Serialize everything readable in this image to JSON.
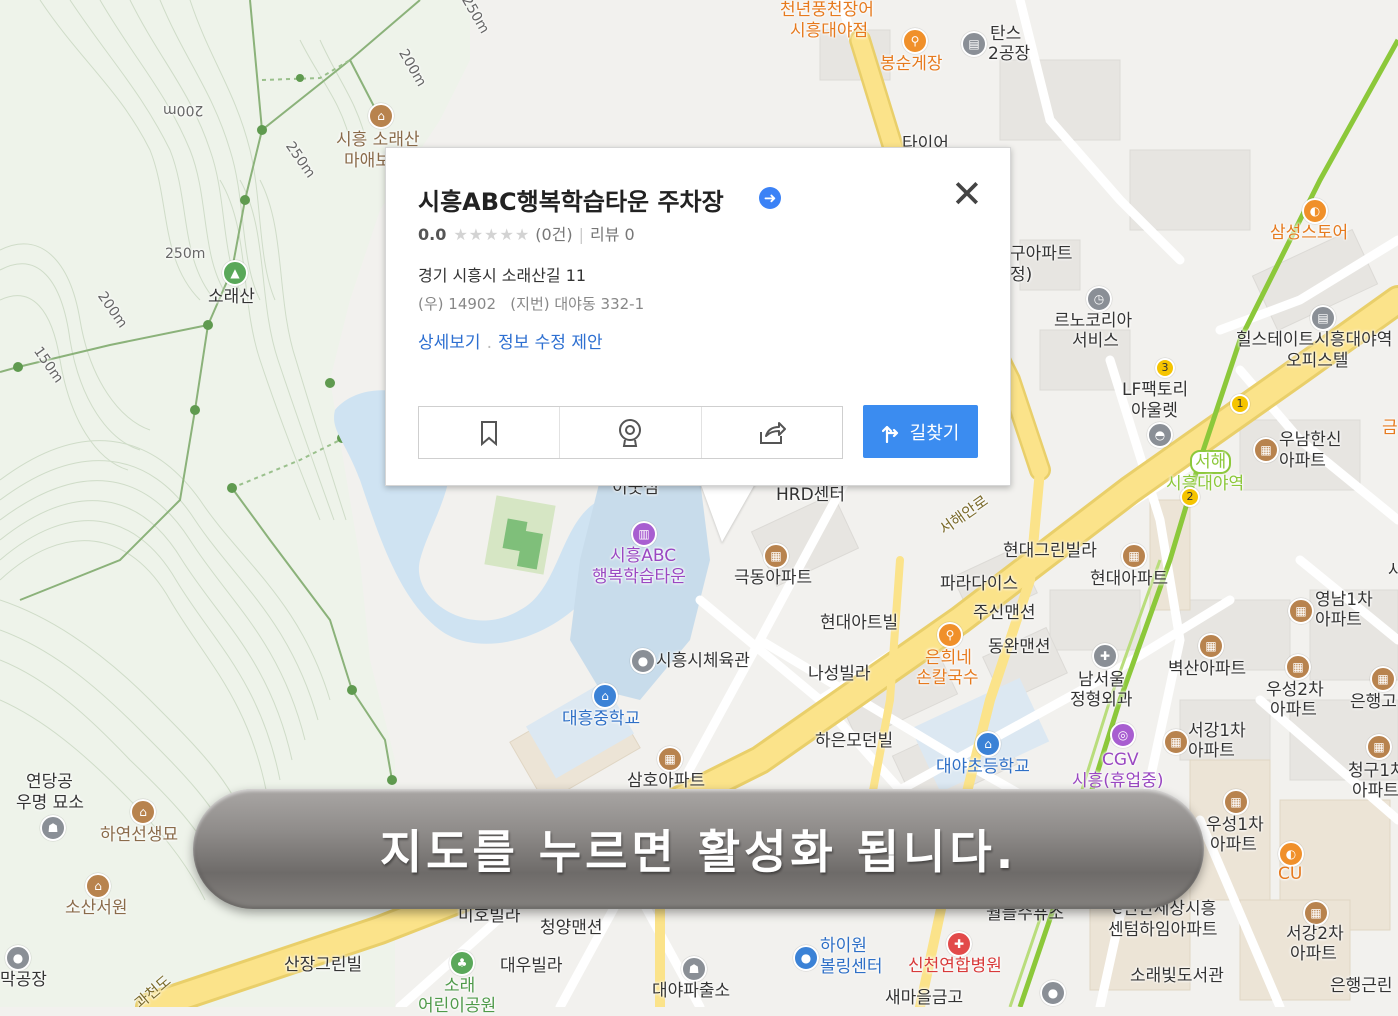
{
  "place": {
    "title": "시흥ABC행복학습타운 주차장",
    "rating_score": "0.0",
    "rating_stars": "★★★★★",
    "rating_count": "(0건)",
    "review_label": "리뷰 0",
    "address": "경기 시흥시 소래산길 11",
    "postal_jibun": "(우) 14902   (지번) 대야동 332-1",
    "link_detail": "상세보기",
    "link_edit": "정보 수정 제안",
    "route_label": "길찾기",
    "close_glyph": "✕",
    "verify_glyph": "➜"
  },
  "banner": {
    "text": "지도를 누르면 활성화 됩니다."
  },
  "map_labels": {
    "cheonnyeon": "천년풍천장어",
    "siheung_daeyajeom": "시흥대야점",
    "bongsun": "봉순게장",
    "tans": "탄스",
    "factory2": "2공장",
    "taieo": "타이어",
    "soraesan_maae": "시흥 소래산",
    "maae": "마애보",
    "soraesan": "소래산",
    "m250a": "250m",
    "m250b": "250m",
    "m250c": "250m",
    "m200a": "200m",
    "m200b": "200m",
    "m200c": "200m",
    "m150": "150m",
    "apt_gu": "구아파트",
    "jeong": "정)",
    "samsung": "삼성스토어",
    "renault1": "르노코리아",
    "renault2": "서비스",
    "hillstate1": "힐스테이트시흥대야역",
    "hillstate2": "오피스텔",
    "lf1": "LF팩토리",
    "lf2": "아울렛",
    "unam1": "우남한신",
    "unam2": "아파트",
    "seohae": "서해",
    "siheungdaeya_st": "시흥대야역",
    "hrd": "HRD센터",
    "seohaean_ro": "서해안로",
    "ieutseom": "이웃섬",
    "abc1": "시흥ABC",
    "abc2": "행복학습타운",
    "geukdong": "극동아파트",
    "hyundaigreen": "현대그린빌라",
    "hyundai_apt": "현대아파트",
    "paradise": "파라다이스",
    "jusin": "주신맨션",
    "yeongnam1": "영남1차",
    "yeongnam2": "아파트",
    "hyundai_artvil": "현대아트빌",
    "eunhee1": "은희네",
    "eunhee2": "손칼국수",
    "dongwan": "동완맨션",
    "namseoul1": "남서울",
    "namseoul2": "정형외과",
    "byeoksan": "벽산아파트",
    "useong2a": "우성2차",
    "useong2b": "아파트",
    "eunhaeng_r": "은행고",
    "gymnasium": "시흥시체육관",
    "naseong": "나성빌라",
    "daeheung_ms": "대흥중학교",
    "haeun": "하은모던빌",
    "daeya_es": "대야초등학교",
    "seogang1a": "서강1차",
    "seogang1b": "아파트",
    "cgv1": "CGV",
    "cgv2": "시흥(휴업중)",
    "cheonggu1": "청구1차",
    "cheonggu2": "아파트",
    "samho": "삼호아파트",
    "yeondang1": "연당공",
    "yeondang2": "우명 묘소",
    "hayeonseon": "하연선생묘",
    "sosan": "소산서원",
    "useong1a": "우성1차",
    "useong1b": "아파트",
    "cu": "CU",
    "miho": "미호빌라",
    "cheongyang": "청양맨션",
    "wolmyeong": "월들수퓨소",
    "sesang1": "e편한세상시흥",
    "sesang2": "센텀하임아파트",
    "seogang2a": "서강2차",
    "seogang2b": "아파트",
    "gongjang": "막공장",
    "sanjang": "산장그린빌",
    "daewoo": "대우빌라",
    "sorae1": "소래",
    "sorae2": "어린이공원",
    "highone1": "하이원",
    "highone2": "볼링센터",
    "sincheon": "신천연합병원",
    "sorae_lib": "소래빛도서관",
    "daeya_police": "대야파출소",
    "saemaeul": "새마을금고",
    "eunhaeng_b": "은행근린",
    "gwacheon": "과천도",
    "geum": "금",
    "sa": "사"
  },
  "colors": {
    "route_button": "#3b8cf0",
    "link": "#2d6fd1",
    "subway_line": "#8cc83a",
    "main_road": "#fbe38a"
  }
}
